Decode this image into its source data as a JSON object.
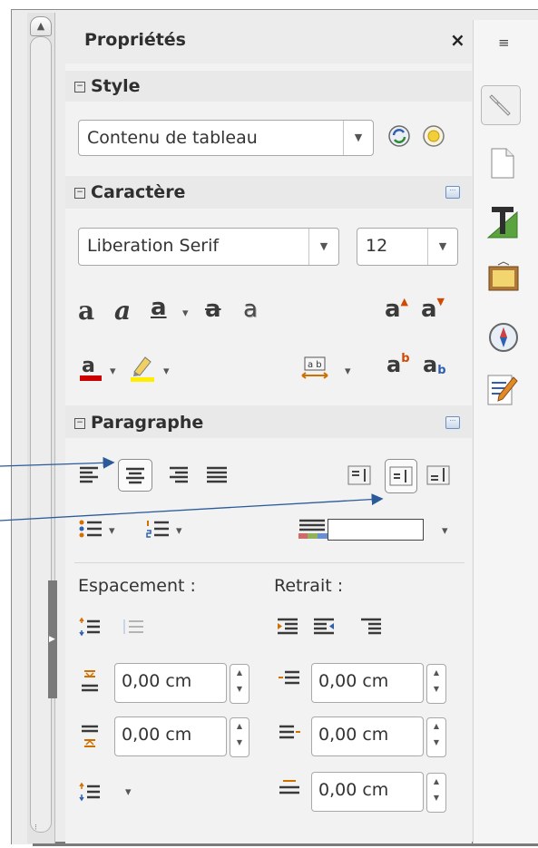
{
  "panel": {
    "title": "Propriétés",
    "close_label": "×"
  },
  "style_section": {
    "title": "Style",
    "style_value": "Contenu de tableau"
  },
  "character_section": {
    "title": "Caractère",
    "font_name": "Liberation Serif",
    "font_size": "12"
  },
  "paragraph_section": {
    "title": "Paragraphe",
    "spacing_label": "Espacement :",
    "indent_label": "Retrait :",
    "above_spacing": "0,00 cm",
    "below_spacing": "0,00 cm",
    "before_indent": "0,00 cm",
    "after_indent": "0,00 cm",
    "first_line_indent": "0,00 cm"
  },
  "colors": {
    "font_color": "#cc0000",
    "highlight_color": "#ffee00",
    "annotation_arrow": "#2a5a9a"
  },
  "icons": {
    "toggle": "⊟",
    "more": "⋯",
    "dropdown": "▾",
    "menu": "≡"
  }
}
